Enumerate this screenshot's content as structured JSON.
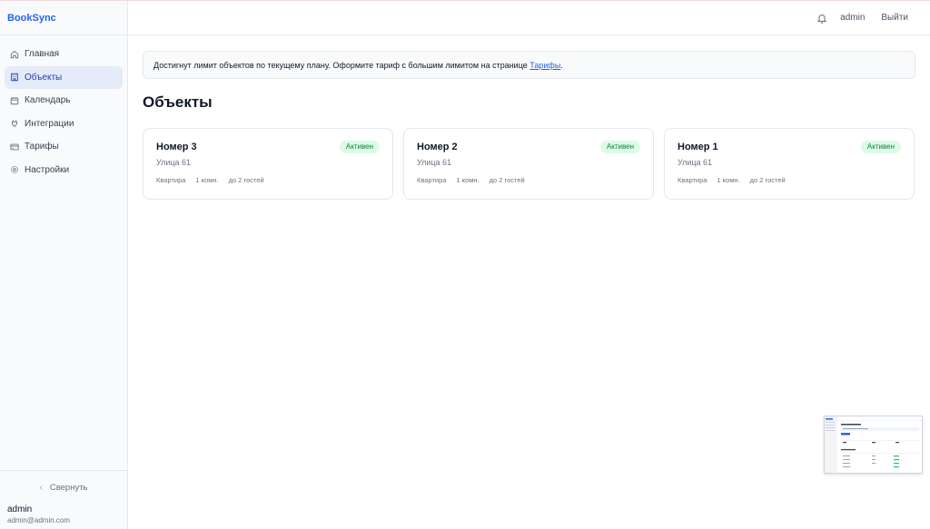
{
  "app": {
    "brand": "BookSync"
  },
  "sidebar": {
    "items": [
      {
        "label": "Главная",
        "icon": "home-icon",
        "active": false
      },
      {
        "label": "Объекты",
        "icon": "building-icon",
        "active": true
      },
      {
        "label": "Календарь",
        "icon": "calendar-icon",
        "active": false
      },
      {
        "label": "Интеграции",
        "icon": "plug-icon",
        "active": false
      },
      {
        "label": "Тарифы",
        "icon": "credit-card-icon",
        "active": false
      },
      {
        "label": "Настройки",
        "icon": "gear-icon",
        "active": false
      }
    ],
    "collapse_label": "Свернуть",
    "user": {
      "name": "admin",
      "email": "admin@admin.com"
    }
  },
  "header": {
    "user": "admin",
    "logout_label": "Выйти"
  },
  "alert": {
    "text": "Достигнут лимит объектов по текущему плану. Оформите тариф с большим лимитом на странице ",
    "link": "Тарифы",
    "suffix": "."
  },
  "main": {
    "title": "Объекты",
    "cards": [
      {
        "title": "Номер 3",
        "status": "Активен",
        "address": "Улица 61",
        "type": "Квартира",
        "rooms": "1 комн.",
        "guests": "до 2 гостей"
      },
      {
        "title": "Номер 2",
        "status": "Активен",
        "address": "Улица 61",
        "type": "Квартира",
        "rooms": "1 комн.",
        "guests": "до 2 гостей"
      },
      {
        "title": "Номер 1",
        "status": "Активен",
        "address": "Улица 61",
        "type": "Квартира",
        "rooms": "1 комн.",
        "guests": "до 2 гостей"
      }
    ]
  },
  "colors": {
    "accent": "#2563eb",
    "active_bg": "#e5ebf9",
    "badge_bg": "#dcfce7",
    "badge_text": "#15803d"
  }
}
